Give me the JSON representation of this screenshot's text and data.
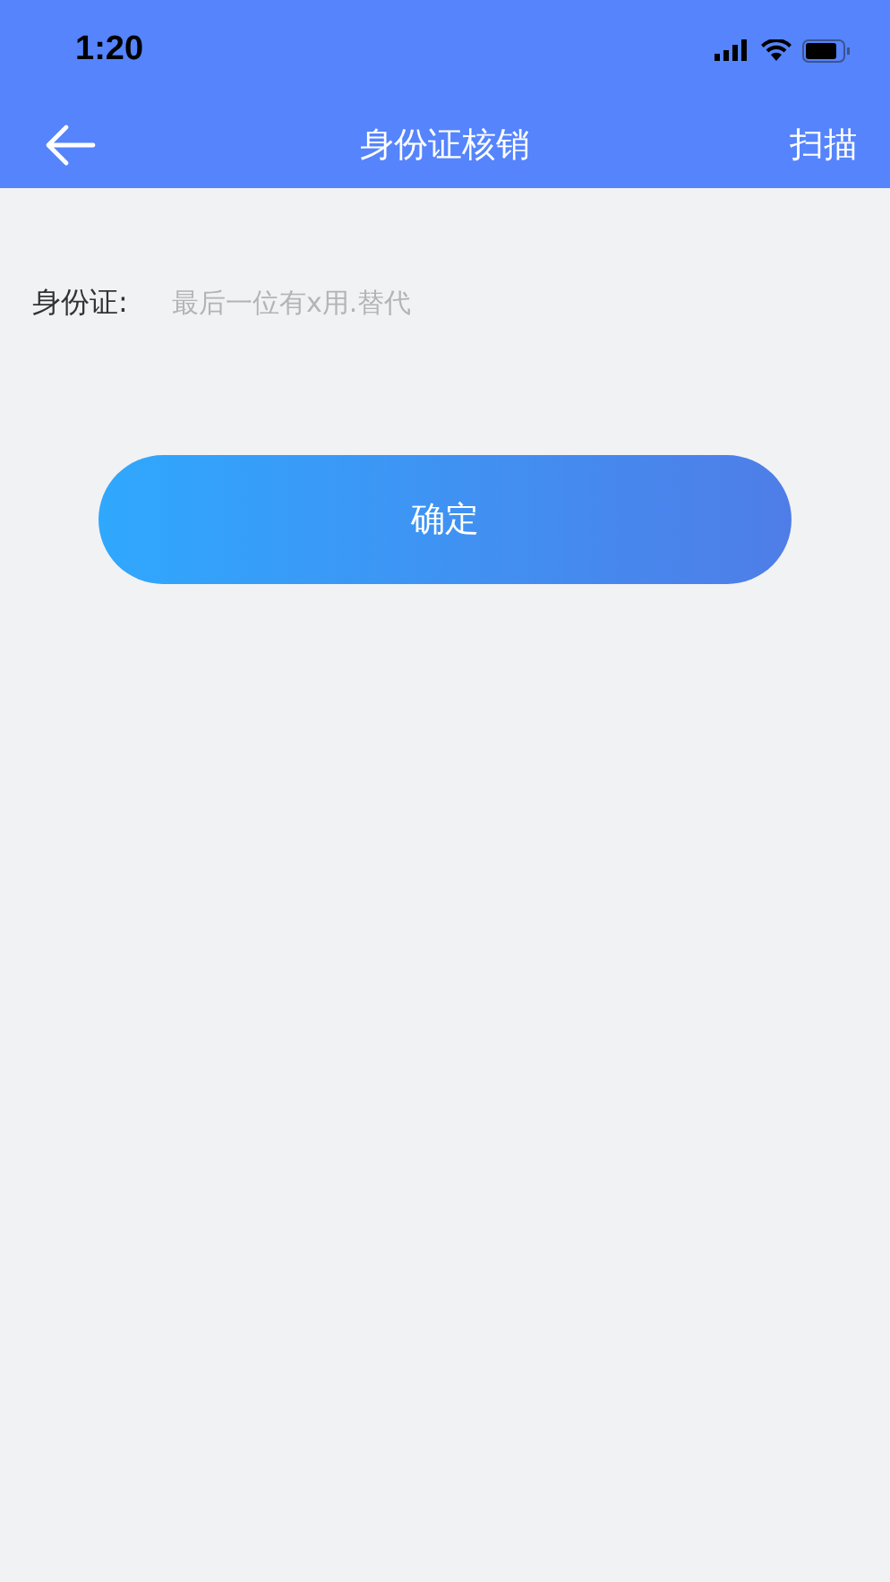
{
  "status_bar": {
    "time": "1:20"
  },
  "nav_bar": {
    "title": "身份证核销",
    "action": "扫描"
  },
  "form": {
    "label": "身份证:",
    "placeholder": "最后一位有x用.替代"
  },
  "confirm_button": {
    "label": "确定"
  }
}
